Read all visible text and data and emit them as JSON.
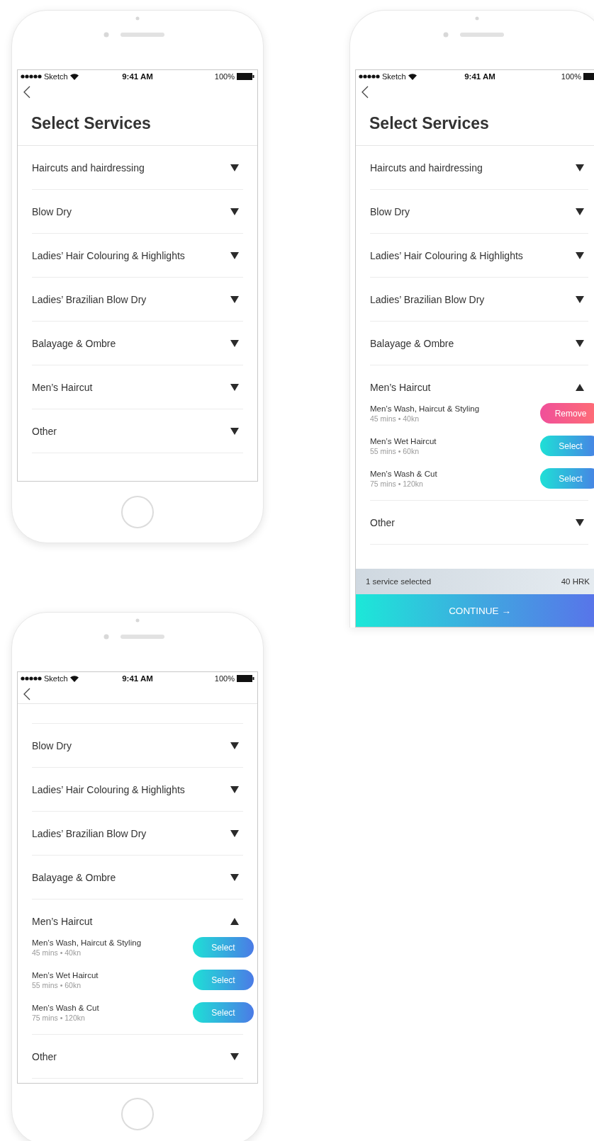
{
  "phones": [
    {
      "status": {
        "carrier": "Sketch",
        "time": "9:41 AM",
        "battery": "100%"
      },
      "title": "Select Services",
      "categories": [
        {
          "name": "Haircuts and hairdressing",
          "expanded": false
        },
        {
          "name": "Blow Dry",
          "expanded": false
        },
        {
          "name": "Ladies’ Hair Colouring & Highlights",
          "expanded": false
        },
        {
          "name": "Ladies’ Brazilian Blow Dry",
          "expanded": false
        },
        {
          "name": "Balayage & Ombre",
          "expanded": false
        },
        {
          "name": "Men’s Haircut",
          "expanded": false
        },
        {
          "name": "Other",
          "expanded": false
        }
      ]
    },
    {
      "status": {
        "carrier": "Sketch",
        "time": "9:41 AM",
        "battery": "100%"
      },
      "title": "Select Services",
      "categories": [
        {
          "name": "Haircuts and hairdressing",
          "expanded": false
        },
        {
          "name": "Blow Dry",
          "expanded": false
        },
        {
          "name": "Ladies’ Hair Colouring & Highlights",
          "expanded": false
        },
        {
          "name": "Ladies’ Brazilian Blow Dry",
          "expanded": false
        },
        {
          "name": "Balayage & Ombre",
          "expanded": false
        },
        {
          "name": "Men’s Haircut",
          "expanded": true,
          "services": [
            {
              "name": "Men’s Wash, Haircut & Styling",
              "details": "45 mins • 40kn",
              "button": "Remove",
              "selected": true
            },
            {
              "name": "Men’s Wet Haircut",
              "details": "55 mins • 60kn",
              "button": "Select",
              "selected": false
            },
            {
              "name": "Men’s Wash & Cut",
              "details": "75 mins • 120kn",
              "button": "Select",
              "selected": false
            }
          ]
        },
        {
          "name": "Other",
          "expanded": false
        }
      ],
      "summary": {
        "count": "1 service selected",
        "total": "40 HRK"
      },
      "continue_label": "CONTINUE →"
    },
    {
      "status": {
        "carrier": "Sketch",
        "time": "9:41 AM",
        "battery": "100%"
      },
      "categories": [
        {
          "name": "Blow Dry",
          "expanded": false
        },
        {
          "name": "Ladies’ Hair Colouring & Highlights",
          "expanded": false
        },
        {
          "name": "Ladies’ Brazilian Blow Dry",
          "expanded": false
        },
        {
          "name": "Balayage & Ombre",
          "expanded": false
        },
        {
          "name": "Men’s Haircut",
          "expanded": true,
          "services": [
            {
              "name": "Men’s Wash, Haircut & Styling",
              "details": "45 mins • 40kn",
              "button": "Select",
              "selected": false
            },
            {
              "name": "Men’s Wet Haircut",
              "details": "55 mins • 60kn",
              "button": "Select",
              "selected": false
            },
            {
              "name": "Men’s Wash & Cut",
              "details": "75 mins • 120kn",
              "button": "Select",
              "selected": false
            }
          ]
        },
        {
          "name": "Other",
          "expanded": false
        }
      ]
    }
  ]
}
